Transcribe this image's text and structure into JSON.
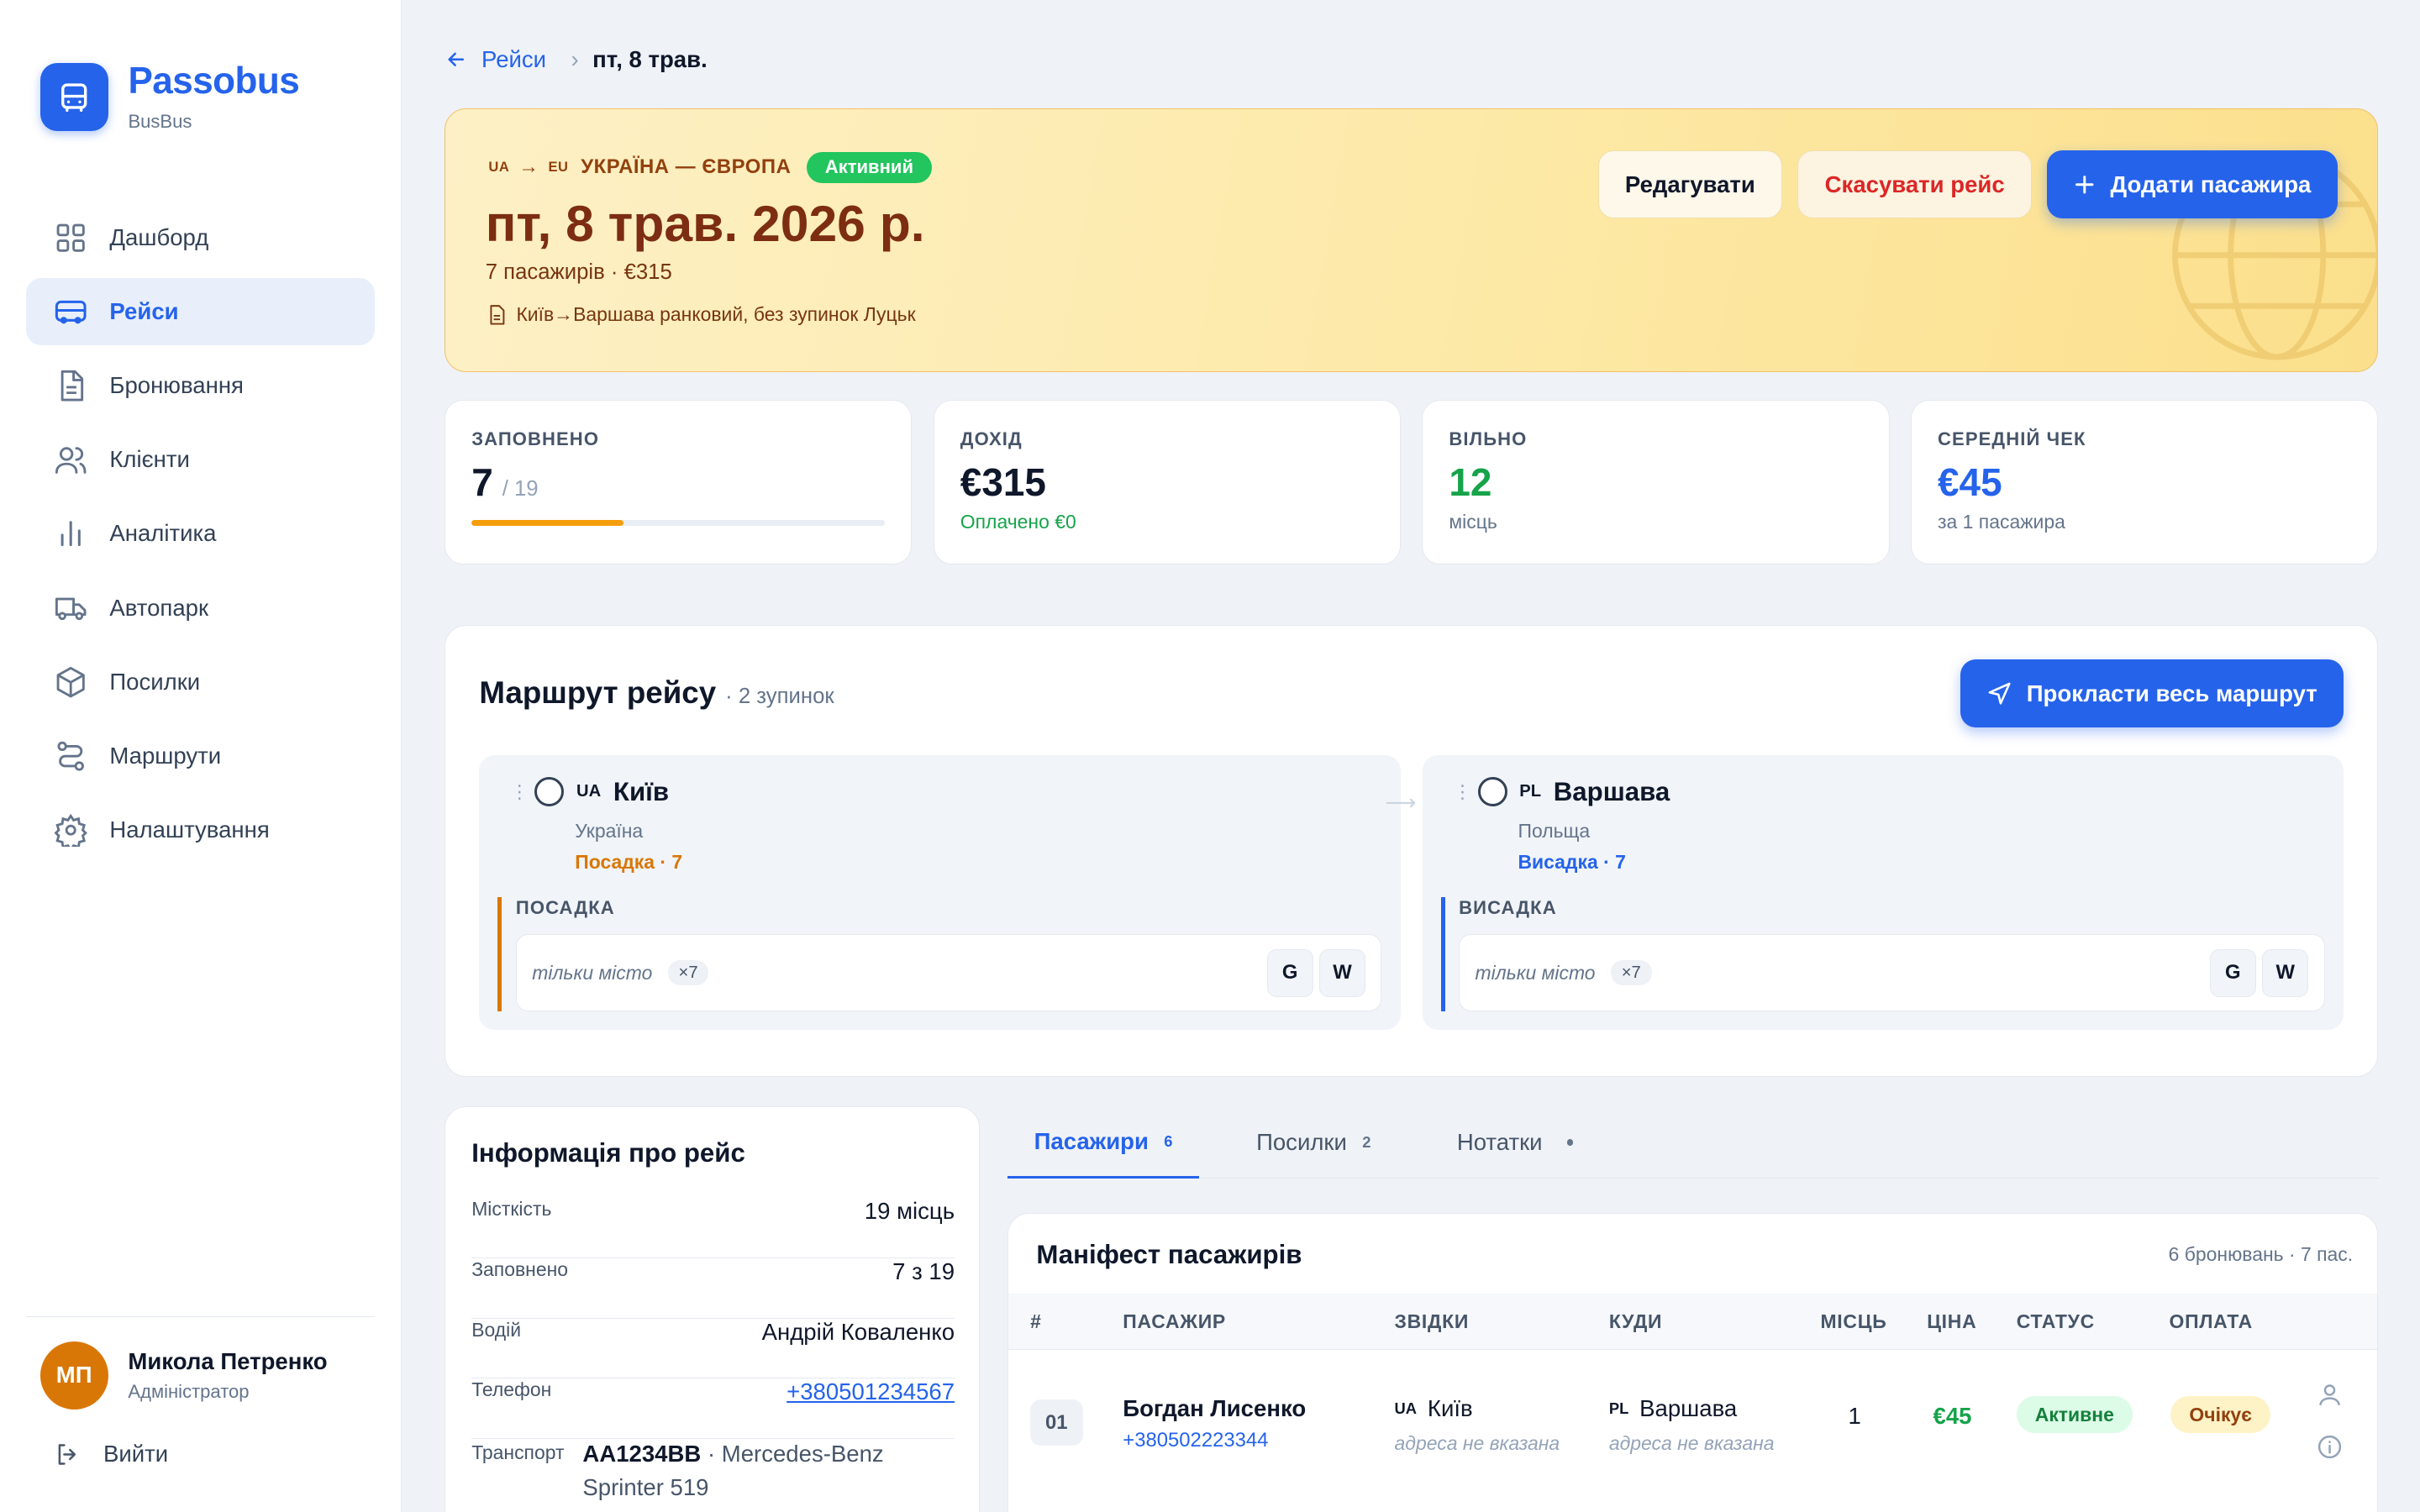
{
  "app": {
    "name": "Passobus",
    "sub": "BusBus"
  },
  "nav": [
    {
      "label": "Дашборд",
      "icon": "grid-icon",
      "active": false
    },
    {
      "label": "Рейси",
      "icon": "bus-icon",
      "active": true
    },
    {
      "label": "Бронювання",
      "icon": "document-icon",
      "active": false
    },
    {
      "label": "Клієнти",
      "icon": "users-icon",
      "active": false
    },
    {
      "label": "Аналітика",
      "icon": "chart-icon",
      "active": false
    },
    {
      "label": "Автопарк",
      "icon": "truck-icon",
      "active": false
    },
    {
      "label": "Посилки",
      "icon": "package-icon",
      "active": false
    },
    {
      "label": "Маршрути",
      "icon": "route-icon",
      "active": false
    },
    {
      "label": "Налаштування",
      "icon": "gear-icon",
      "active": false
    }
  ],
  "user": {
    "initials": "МП",
    "name": "Микола Петренко",
    "role": "Адміністратор",
    "logout": "Вийти"
  },
  "breadcrumb": {
    "back": "Рейси",
    "current": "пт, 8 трав."
  },
  "hero": {
    "from_cc": "UA",
    "to_cc": "EU",
    "route": "УКРАЇНА — ЄВРОПА",
    "status": "Активний",
    "date": "пт, 8 трав. 2026 р.",
    "meta": "7 пасажирів · €315",
    "note": "Київ→Варшава ранковий, без зупинок Луцьк",
    "buttons": {
      "edit": "Редагувати",
      "cancel": "Скасувати рейс",
      "add": "Додати пасажира"
    }
  },
  "stats": {
    "filled": {
      "label": "ЗАПОВНЕНО",
      "value": "7",
      "of": "/ 19",
      "fraction": 0.368
    },
    "income": {
      "label": "ДОХІД",
      "value": "€315",
      "sub": "Оплачено €0"
    },
    "free": {
      "label": "ВІЛЬНО",
      "value": "12",
      "sub": "місць"
    },
    "avg": {
      "label": "СЕРЕДНІЙ ЧЕК",
      "value": "€45",
      "sub": "за 1 пасажира"
    }
  },
  "route": {
    "title": "Маршрут рейсу",
    "count": "· 2 зупинок",
    "button": "Прокласти весь маршрут",
    "stops": [
      {
        "cc": "UA",
        "name": "Київ",
        "country": "Україна",
        "action": "Посадка · 7",
        "section": "ПОСАДКА",
        "only": "тільки місто",
        "mult": "×7",
        "g": "G",
        "w": "W",
        "color": "#d97706"
      },
      {
        "cc": "PL",
        "name": "Варшава",
        "country": "Польща",
        "action": "Висадка · 7",
        "section": "ВИСАДКА",
        "only": "тільки місто",
        "mult": "×7",
        "g": "G",
        "w": "W",
        "color": "#2563eb"
      }
    ]
  },
  "info": {
    "title": "Інформація про рейс",
    "rows": [
      {
        "k": "Місткість",
        "v": "19 місць"
      },
      {
        "k": "Заповнено",
        "v": "7 з 19"
      },
      {
        "k": "Водій",
        "v": "Андрій Коваленко"
      },
      {
        "k": "Телефон",
        "v": "+380501234567"
      }
    ],
    "transport": {
      "k": "Транспорт",
      "plate": "AA1234BB",
      "model": "· Mercedes-Benz Sprinter 519"
    }
  },
  "tabs": [
    {
      "label": "Пасажири",
      "count": "6",
      "active": true
    },
    {
      "label": "Посилки",
      "count": "2",
      "active": false
    },
    {
      "label": "Нотатки",
      "count": "",
      "active": false
    }
  ],
  "manifest": {
    "title": "Маніфест пасажирів",
    "count": "6 бронювань · 7 пас.",
    "columns": [
      "#",
      "ПАСАЖИР",
      "ЗВІДКИ",
      "КУДИ",
      "МІСЦЬ",
      "ЦІНА",
      "СТАТУС",
      "ОПЛАТА"
    ],
    "rows": [
      {
        "num": "01",
        "name": "Богдан Лисенко",
        "phone": "+380502223344",
        "from_cc": "UA",
        "from": "Київ",
        "from_addr": "адреса не вказана",
        "to_cc": "PL",
        "to": "Варшава",
        "to_addr": "адреса не вказана",
        "seats": "1",
        "price": "€45",
        "status": "Активне",
        "payment": "Очікує"
      }
    ]
  },
  "colors": {
    "accent": "#2563eb",
    "hero_text": "#7c2d12",
    "green": "#16a34a",
    "amber": "#d97706"
  }
}
